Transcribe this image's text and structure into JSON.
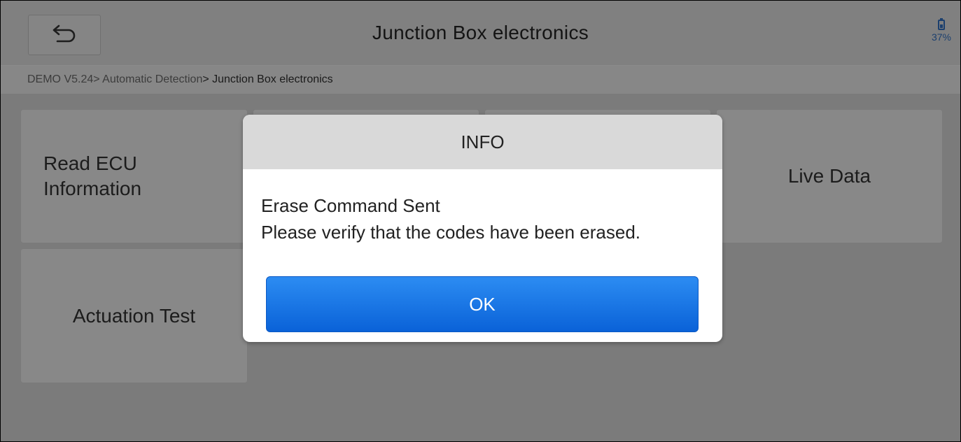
{
  "header": {
    "title": "Junction Box electronics",
    "battery_percent": "37%",
    "back_icon": "back-arrow-icon"
  },
  "breadcrumb": {
    "path_prefix": "DEMO V5.24> Automatic Detection",
    "current": "> Junction Box electronics"
  },
  "menu": {
    "read_ecu_line1": "Read ECU",
    "read_ecu_line2": "Information",
    "live_data": "Live Data",
    "actuation_test": "Actuation Test"
  },
  "dialog": {
    "title": "INFO",
    "line1": "Erase Command Sent",
    "line2": "Please verify that the codes have been erased.",
    "ok_label": "OK"
  },
  "colors": {
    "ok_button": "#1572e8",
    "battery": "#1b3f6e"
  }
}
